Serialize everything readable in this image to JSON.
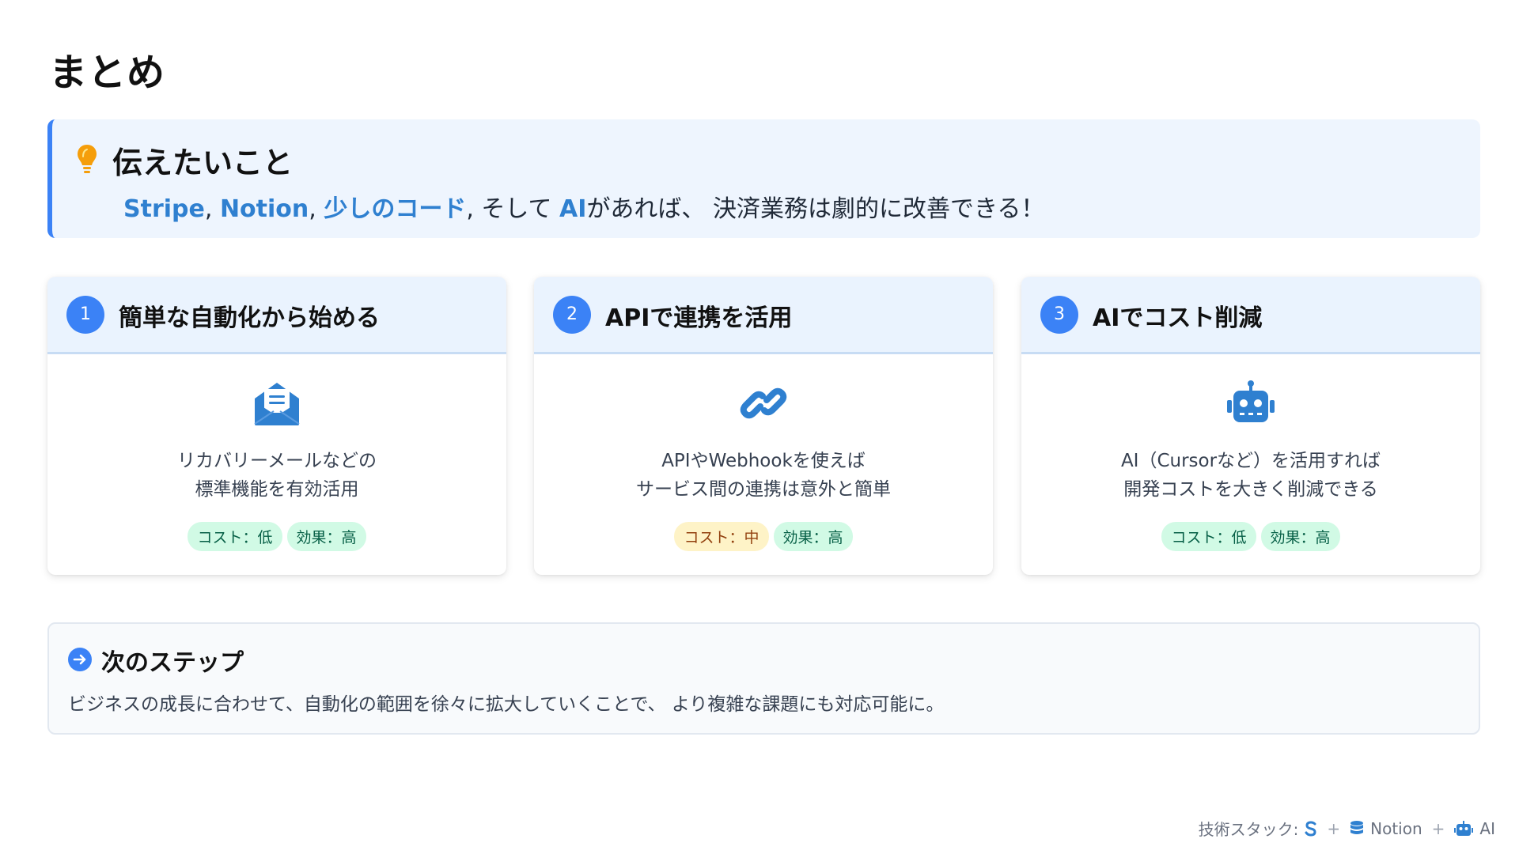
{
  "page": {
    "title": "まとめ"
  },
  "key_message": {
    "title": "伝えたいこと",
    "icon": "lightbulb-icon",
    "parts": {
      "stripe": "Stripe",
      "sep1": ", ",
      "notion": "Notion",
      "sep2": ", ",
      "code": "少しのコード",
      "sep3": ", そして ",
      "ai": "AI",
      "rest": "があれば、 決済業務は劇的に改善できる！"
    }
  },
  "cards": [
    {
      "number": "1",
      "title": "簡単な自動化から始める",
      "icon": "envelope-open-icon",
      "desc": [
        "リカバリーメールなどの",
        "標準機能を有効活用"
      ],
      "badges": [
        {
          "label": "コスト：低",
          "color": "green"
        },
        {
          "label": "効果：高",
          "color": "green"
        }
      ]
    },
    {
      "number": "2",
      "title": "APIで連携を活用",
      "icon": "link-icon",
      "desc": [
        "APIやWebhookを使えば",
        "サービス間の連携は意外と簡単"
      ],
      "badges": [
        {
          "label": "コスト：中",
          "color": "yellow"
        },
        {
          "label": "効果：高",
          "color": "green"
        }
      ]
    },
    {
      "number": "3",
      "title": "AIでコスト削減",
      "icon": "robot-icon",
      "desc": [
        "AI（Cursorなど）を活用すれば",
        "開発コストを大きく削減できる"
      ],
      "badges": [
        {
          "label": "コスト：低",
          "color": "green"
        },
        {
          "label": "効果：高",
          "color": "green"
        }
      ]
    }
  ],
  "next_steps": {
    "icon": "arrow-circle-right-icon",
    "title": "次のステップ",
    "text": "ビジネスの成長に合わせて、自動化の範囲を徐々に拡大していくことで、 より複雑な課題にも対応可能に。"
  },
  "footer": {
    "label": "技術スタック:",
    "plus": "+",
    "notion": "Notion",
    "ai": "AI"
  },
  "colors": {
    "accent": "#3b82f6",
    "highlight": "#2f80d0",
    "bulb": "#f59e0b",
    "badge_green_bg": "#d1fae5",
    "badge_yellow_bg": "#fef3c7"
  }
}
